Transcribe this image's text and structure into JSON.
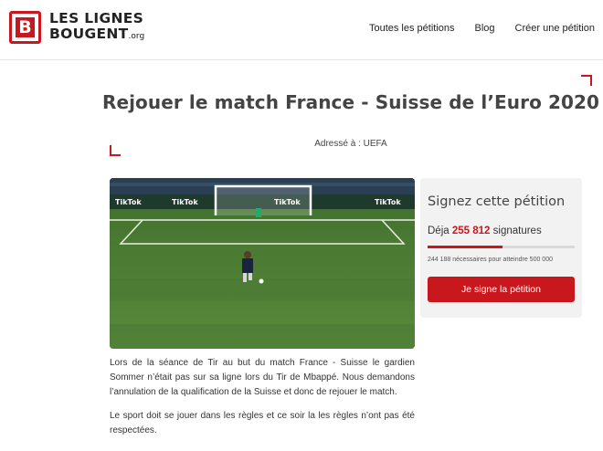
{
  "brand": {
    "mark_letter": "B",
    "line1": "LES LIGNES",
    "line2": "BOUGENT",
    "suffix": ".org"
  },
  "nav": {
    "items": [
      "Toutes les pétitions",
      "Blog",
      "Créer une pétition"
    ]
  },
  "petition": {
    "title": "Rejouer le match France - Suisse de l’Euro 2020",
    "addressed_to": "Adressé à : UEFA",
    "image_banner_text": "TikTok",
    "paragraphs": [
      "Lors de la séance de Tir au but du match France - Suisse le gardien Sommer n’était pas sur sa ligne lors du Tir de Mbappé. Nous demandons l’annulation de la qualification de la Suisse et donc de rejouer le match.",
      "Le sport doit se jouer dans les règles et ce soir la les règles n’ont pas été respectées."
    ]
  },
  "sign_card": {
    "title": "Signez cette pétition",
    "count_prefix": "Déja",
    "count": "255 812",
    "count_suffix": "signatures",
    "goal_text": "244 188 nécessaires pour atteindre 500 000",
    "progress_fraction": 0.51,
    "button_label": "Je signe la pétition"
  },
  "colors": {
    "accent": "#c8181e",
    "card_bg": "#f2f2f2"
  }
}
